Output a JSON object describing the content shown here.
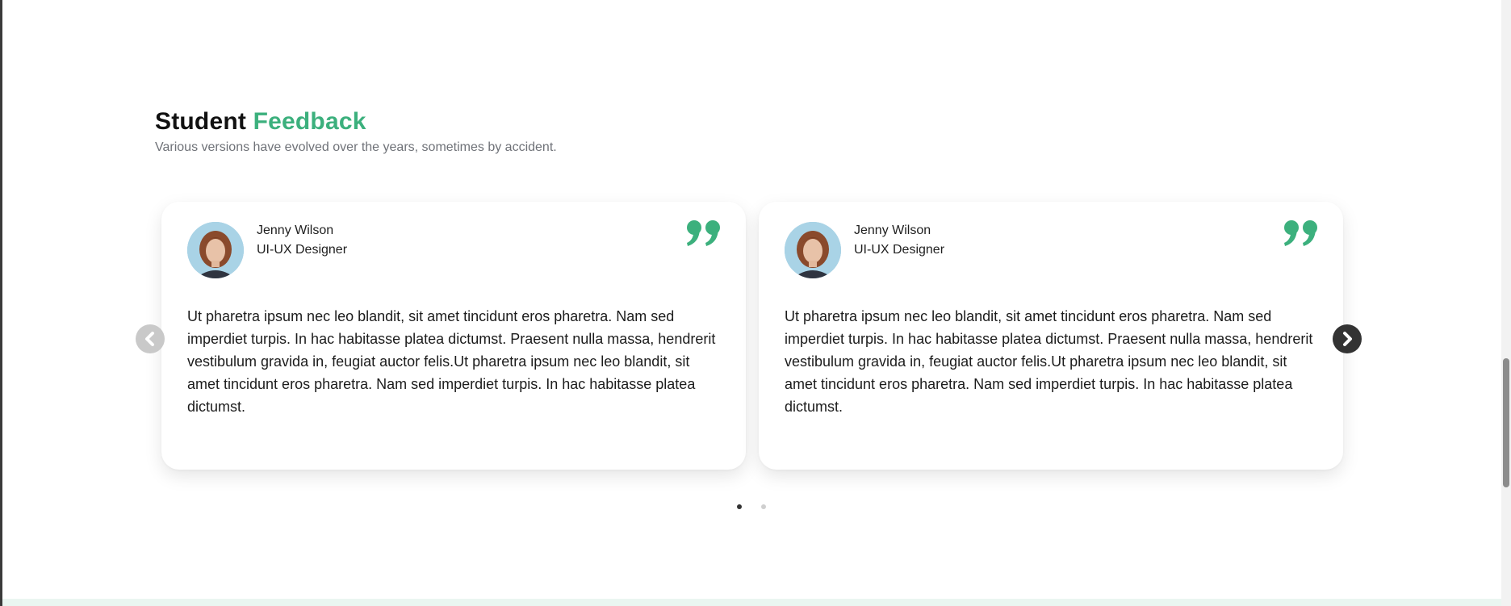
{
  "section": {
    "title_main": "Student",
    "title_accent": "Feedback",
    "subtitle": "Various versions have evolved over the years, sometimes by accident."
  },
  "colors": {
    "accent": "#3cb07d",
    "text_dark": "#111111",
    "muted": "#6f7278",
    "arrow_inactive": "#c9c9c9",
    "arrow_active": "#333333"
  },
  "carousel": {
    "prev_icon": "chevron-left-icon",
    "next_icon": "chevron-right-icon",
    "dots": [
      "active",
      "inactive"
    ]
  },
  "testimonials": [
    {
      "name": "Jenny Wilson",
      "role": "UI-UX Designer",
      "avatar": "avatar-photo",
      "quote_icon": "quote-icon",
      "text": "Ut pharetra ipsum nec leo blandit, sit amet tincidunt eros pharetra. Nam sed imperdiet turpis. In hac habitasse platea dictumst. Praesent nulla massa, hendrerit vestibulum gravida in, feugiat auctor felis.Ut pharetra ipsum nec leo blandit, sit amet tincidunt eros pharetra. Nam sed imperdiet turpis. In hac habitasse platea dictumst."
    },
    {
      "name": "Jenny Wilson",
      "role": "UI-UX Designer",
      "avatar": "avatar-photo",
      "quote_icon": "quote-icon",
      "text": "Ut pharetra ipsum nec leo blandit, sit amet tincidunt eros pharetra. Nam sed imperdiet turpis. In hac habitasse platea dictumst. Praesent nulla massa, hendrerit vestibulum gravida in, feugiat auctor felis.Ut pharetra ipsum nec leo blandit, sit amet tincidunt eros pharetra. Nam sed imperdiet turpis. In hac habitasse platea dictumst."
    }
  ]
}
